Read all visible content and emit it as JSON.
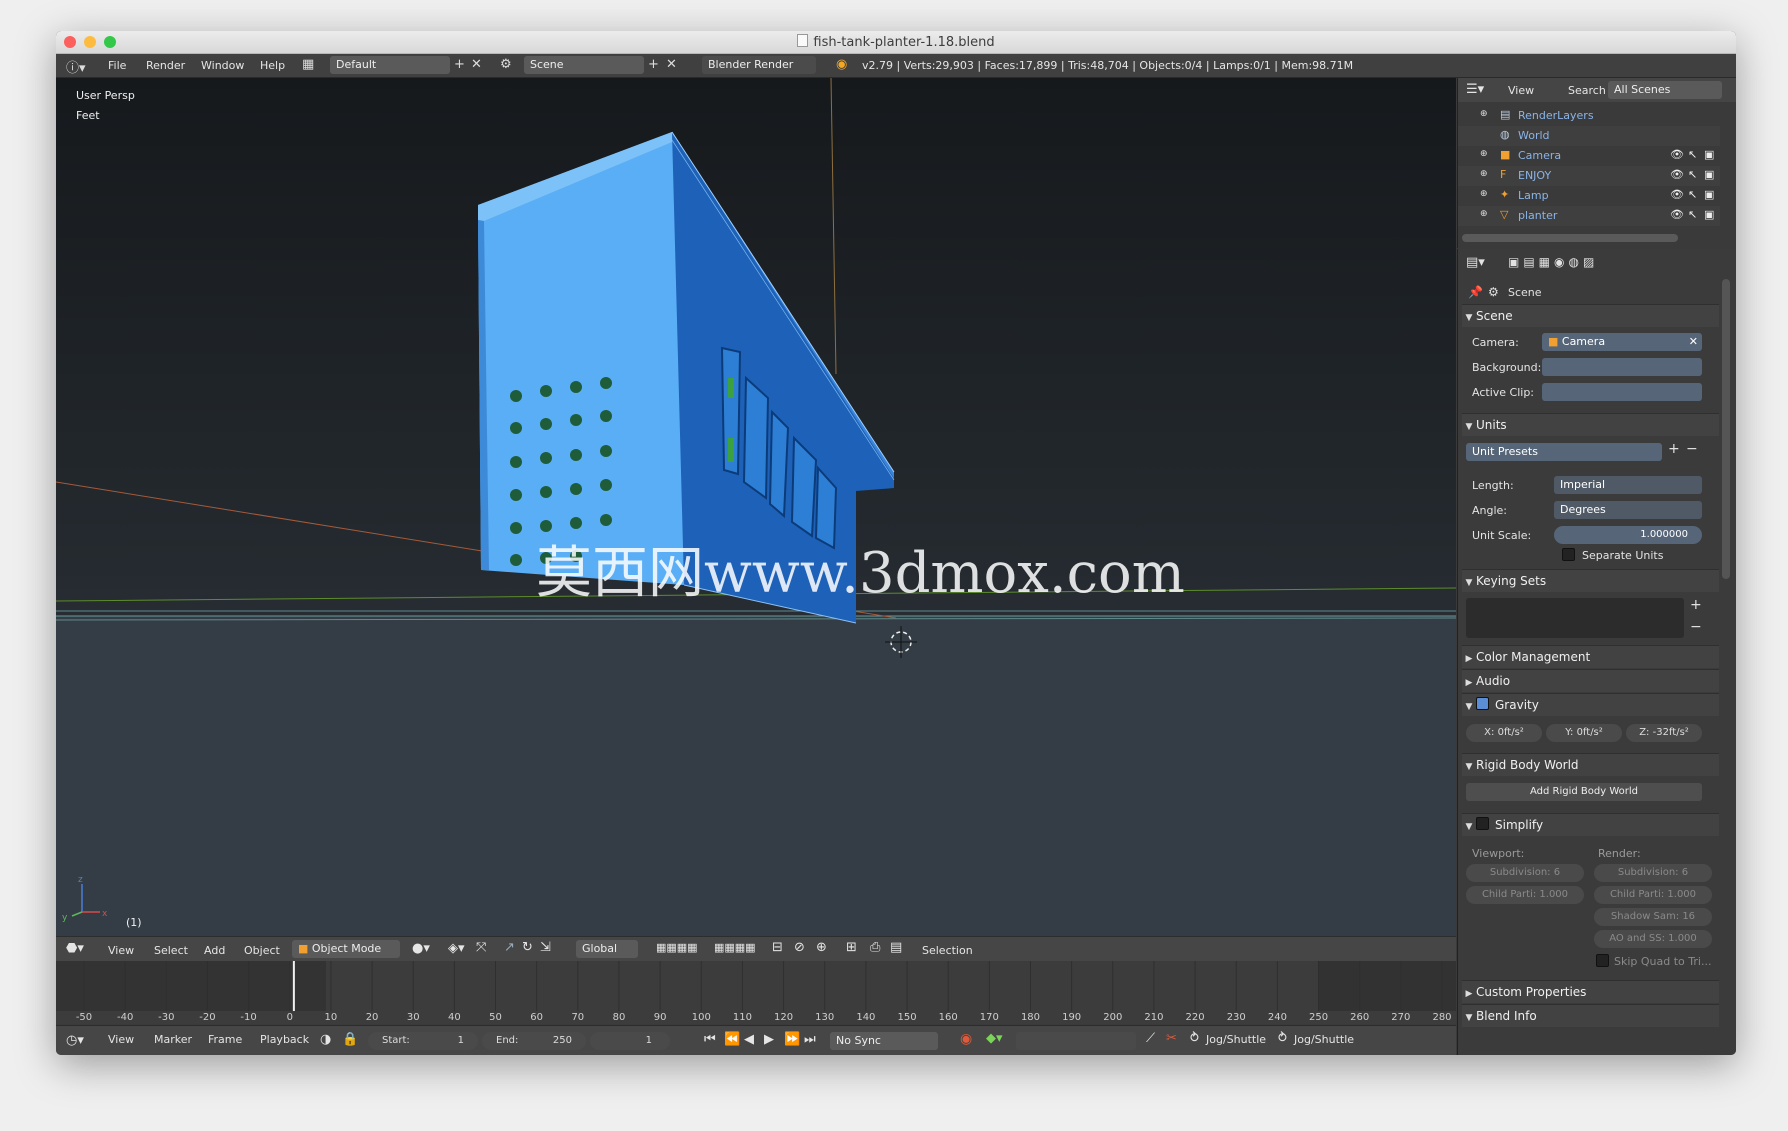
{
  "window": {
    "title": "fish-tank-planter-1.18.blend"
  },
  "menu": {
    "file": "File",
    "render": "Render",
    "window": "Window",
    "help": "Help"
  },
  "screen_layout": "Default",
  "scene_name": "Scene",
  "render_engine": "Blender Render",
  "stats": "v2.79 | Verts:29,903 | Faces:17,899 | Tris:48,704 | Objects:0/4 | Lamps:0/1 | Mem:98.71M",
  "viewport": {
    "view_name": "User Persp",
    "units": "Feet",
    "frame_label": "(1)",
    "watermark": "莫西网www.3dmox.com"
  },
  "view3d_header": {
    "view": "View",
    "select": "Select",
    "add": "Add",
    "object": "Object",
    "mode": "Object Mode",
    "orientation": "Global",
    "selection": "Selection"
  },
  "timeline": {
    "ticks": [
      "-50",
      "-40",
      "-30",
      "-20",
      "-10",
      "0",
      "10",
      "20",
      "30",
      "40",
      "50",
      "60",
      "70",
      "80",
      "90",
      "100",
      "110",
      "120",
      "130",
      "140",
      "150",
      "160",
      "170",
      "180",
      "190",
      "200",
      "210",
      "220",
      "230",
      "240",
      "250",
      "260",
      "270",
      "280"
    ],
    "current_frame": 1,
    "header": {
      "view": "View",
      "marker": "Marker",
      "frame": "Frame",
      "playback": "Playback",
      "start_label": "Start:",
      "start": "1",
      "end_label": "End:",
      "end": "250",
      "current": "1",
      "sync": "No Sync",
      "jog1": "Jog/Shuttle",
      "jog2": "Jog/Shuttle"
    }
  },
  "outliner": {
    "header": {
      "view": "View",
      "search": "Search",
      "filter": "All Scenes"
    },
    "rows": [
      {
        "label": "RenderLayers",
        "icon": "render-layers-icon"
      },
      {
        "label": "World",
        "icon": "world-icon"
      },
      {
        "label": "Camera",
        "icon": "camera-icon"
      },
      {
        "label": "ENJOY",
        "icon": "font-icon"
      },
      {
        "label": "Lamp",
        "icon": "lamp-icon"
      },
      {
        "label": "planter",
        "icon": "mesh-icon"
      }
    ]
  },
  "properties": {
    "context": "Scene",
    "scene_panel": {
      "title": "Scene",
      "camera_label": "Camera:",
      "camera_value": "Camera",
      "background_label": "Background:",
      "active_clip_label": "Active Clip:"
    },
    "units_panel": {
      "title": "Units",
      "unit_presets": "Unit Presets",
      "length_label": "Length:",
      "length_value": "Imperial",
      "angle_label": "Angle:",
      "angle_value": "Degrees",
      "unit_scale_label": "Unit Scale:",
      "unit_scale_value": "1.000000",
      "separate_units": "Separate Units"
    },
    "keying_sets_panel": {
      "title": "Keying Sets"
    },
    "color_management": "Color Management",
    "audio": "Audio",
    "gravity_panel": {
      "title": "Gravity",
      "x": "X:",
      "x_val": "0ft/s²",
      "y": "Y:",
      "y_val": "0ft/s²",
      "z": "Z: -32ft/s²"
    },
    "rigid_body_panel": {
      "title": "Rigid Body World",
      "add_button": "Add Rigid Body World"
    },
    "simplify_panel": {
      "title": "Simplify",
      "viewport": "Viewport:",
      "render": "Render:",
      "vp_subdivision": "Subdivision:",
      "vp_subdivision_val": "6",
      "vp_child": "Child Parti: 1.000",
      "r_subdivision": "Subdivision:",
      "r_subdivision_val": "6",
      "r_child": "Child Parti: 1.000",
      "shadow": "Shadow Sam: 16",
      "ao": "AO and SS: 1.000",
      "skip_quad": "Skip Quad to Tri..."
    },
    "custom_properties": "Custom Properties",
    "blend_info": "Blend Info"
  }
}
